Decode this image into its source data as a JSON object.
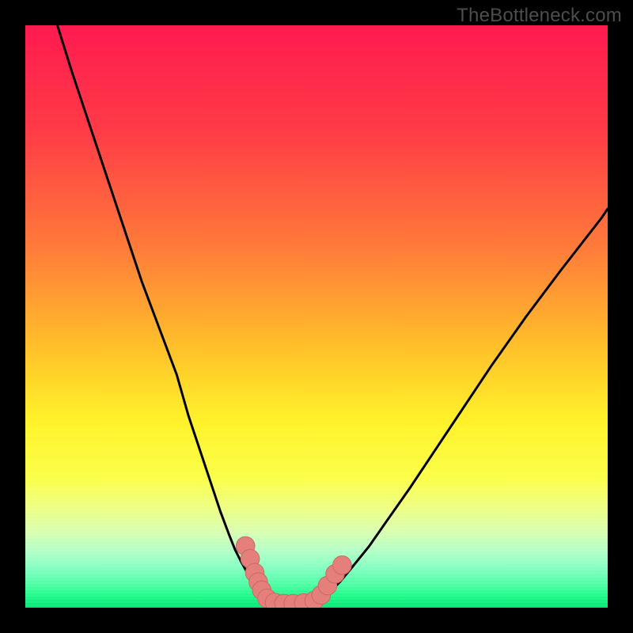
{
  "watermark": "TheBottleneck.com",
  "colors": {
    "gradient_stops": [
      {
        "pct": 0.0,
        "color": "#ff1a50"
      },
      {
        "pct": 18.0,
        "color": "#ff3b47"
      },
      {
        "pct": 38.0,
        "color": "#ff7a3a"
      },
      {
        "pct": 55.0,
        "color": "#ffbf2a"
      },
      {
        "pct": 68.0,
        "color": "#fff22b"
      },
      {
        "pct": 78.0,
        "color": "#fbff4b"
      },
      {
        "pct": 83.0,
        "color": "#edff85"
      },
      {
        "pct": 87.0,
        "color": "#d8ffb0"
      },
      {
        "pct": 90.0,
        "color": "#b6ffc6"
      },
      {
        "pct": 93.0,
        "color": "#86ffc2"
      },
      {
        "pct": 96.0,
        "color": "#4dffa6"
      },
      {
        "pct": 98.0,
        "color": "#1dfb89"
      },
      {
        "pct": 100.0,
        "color": "#05e574"
      }
    ],
    "curve": "#000000",
    "marker_fill": "#e57f7b",
    "marker_stroke": "#c96a66",
    "frame": "#000000"
  },
  "chart_data": {
    "type": "line",
    "title": "",
    "xlabel": "",
    "ylabel": "",
    "xlim": [
      0,
      100
    ],
    "ylim": [
      0,
      100
    ],
    "series": [
      {
        "name": "left-curve",
        "x": [
          5.5,
          8,
          11,
          14,
          17,
          20,
          23,
          26,
          28,
          30,
          32,
          33.5,
          35,
          36,
          37,
          38,
          38.8,
          39.5,
          40.2,
          40.9,
          41.5
        ],
        "y": [
          100,
          92,
          83,
          74,
          65,
          56,
          48,
          40,
          33,
          27,
          21,
          16.5,
          12.5,
          10,
          8,
          6.2,
          4.8,
          3.6,
          2.6,
          1.7,
          1.0
        ]
      },
      {
        "name": "floor",
        "x": [
          41.5,
          44,
          47,
          50
        ],
        "y": [
          1.0,
          0.6,
          0.6,
          1.0
        ]
      },
      {
        "name": "right-curve",
        "x": [
          50,
          51,
          52.2,
          54,
          56,
          59,
          62,
          66,
          70,
          75,
          80,
          86,
          92,
          99,
          100
        ],
        "y": [
          1.0,
          1.6,
          2.6,
          4.4,
          6.8,
          10.5,
          14.8,
          20.5,
          26.5,
          34,
          41.5,
          50,
          58,
          67,
          68.5
        ]
      }
    ],
    "markers": [
      {
        "x": 37.8,
        "y": 10.6,
        "r": 1.6
      },
      {
        "x": 38.6,
        "y": 8.4,
        "r": 1.6
      },
      {
        "x": 39.4,
        "y": 6.0,
        "r": 1.6
      },
      {
        "x": 40.0,
        "y": 4.4,
        "r": 1.6
      },
      {
        "x": 40.6,
        "y": 3.0,
        "r": 1.6
      },
      {
        "x": 41.5,
        "y": 1.6,
        "r": 1.6
      },
      {
        "x": 42.8,
        "y": 0.9,
        "r": 1.6
      },
      {
        "x": 44.4,
        "y": 0.7,
        "r": 1.6
      },
      {
        "x": 46.0,
        "y": 0.7,
        "r": 1.6
      },
      {
        "x": 47.8,
        "y": 0.8,
        "r": 1.6
      },
      {
        "x": 49.6,
        "y": 1.2,
        "r": 1.6
      },
      {
        "x": 50.8,
        "y": 2.2,
        "r": 1.6
      },
      {
        "x": 51.9,
        "y": 3.8,
        "r": 1.6
      },
      {
        "x": 53.2,
        "y": 5.8,
        "r": 1.6
      },
      {
        "x": 54.4,
        "y": 7.3,
        "r": 1.6
      }
    ]
  }
}
